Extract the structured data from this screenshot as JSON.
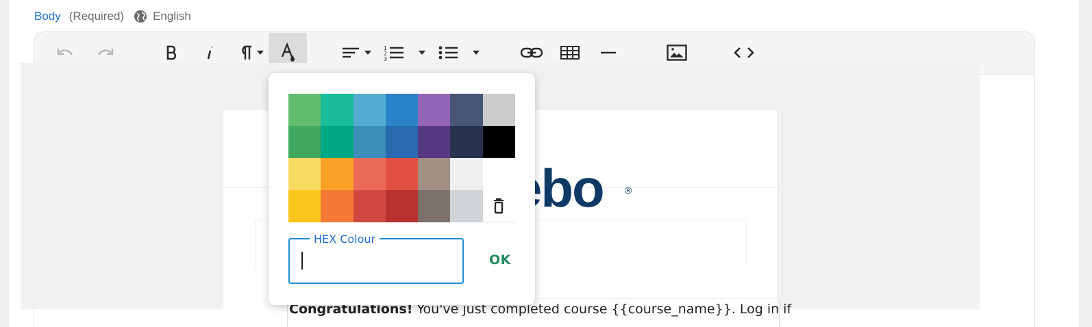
{
  "field": {
    "label": "Body",
    "required": "(Required)",
    "language": "English"
  },
  "toolbar": {
    "buttons": [
      "undo",
      "redo",
      "bold",
      "italic",
      "paragraph-format",
      "text-color",
      "align",
      "ordered-list",
      "unordered-list",
      "link",
      "table",
      "horizontal-rule",
      "image",
      "code-view"
    ],
    "active": "text-color"
  },
  "color_picker": {
    "swatches": [
      "#61BD6D",
      "#1ABC9C",
      "#54ACD2",
      "#2C82C9",
      "#9365B8",
      "#475577",
      "#CCCCCC",
      "#41A85F",
      "#00A885",
      "#3D8EB9",
      "#2969B0",
      "#553982",
      "#28324E",
      "#000000",
      "#F7DA64",
      "#FBA026",
      "#EB6B56",
      "#E25041",
      "#A38F84",
      "#EFEFEF",
      "#FFFFFF",
      "#FAC51C",
      "#F37934",
      "#D14841",
      "#B8312F",
      "#7C706B",
      "#D1D5D8",
      "clear"
    ],
    "hex_label": "HEX Colour",
    "hex_value": "",
    "ok_label": "OK"
  },
  "email_preview": {
    "logo_text": "ebo",
    "logo_mark": "®",
    "body_bold": "Congratulations!",
    "body_rest": " You've just completed course {{course_name}}. Log in if"
  }
}
